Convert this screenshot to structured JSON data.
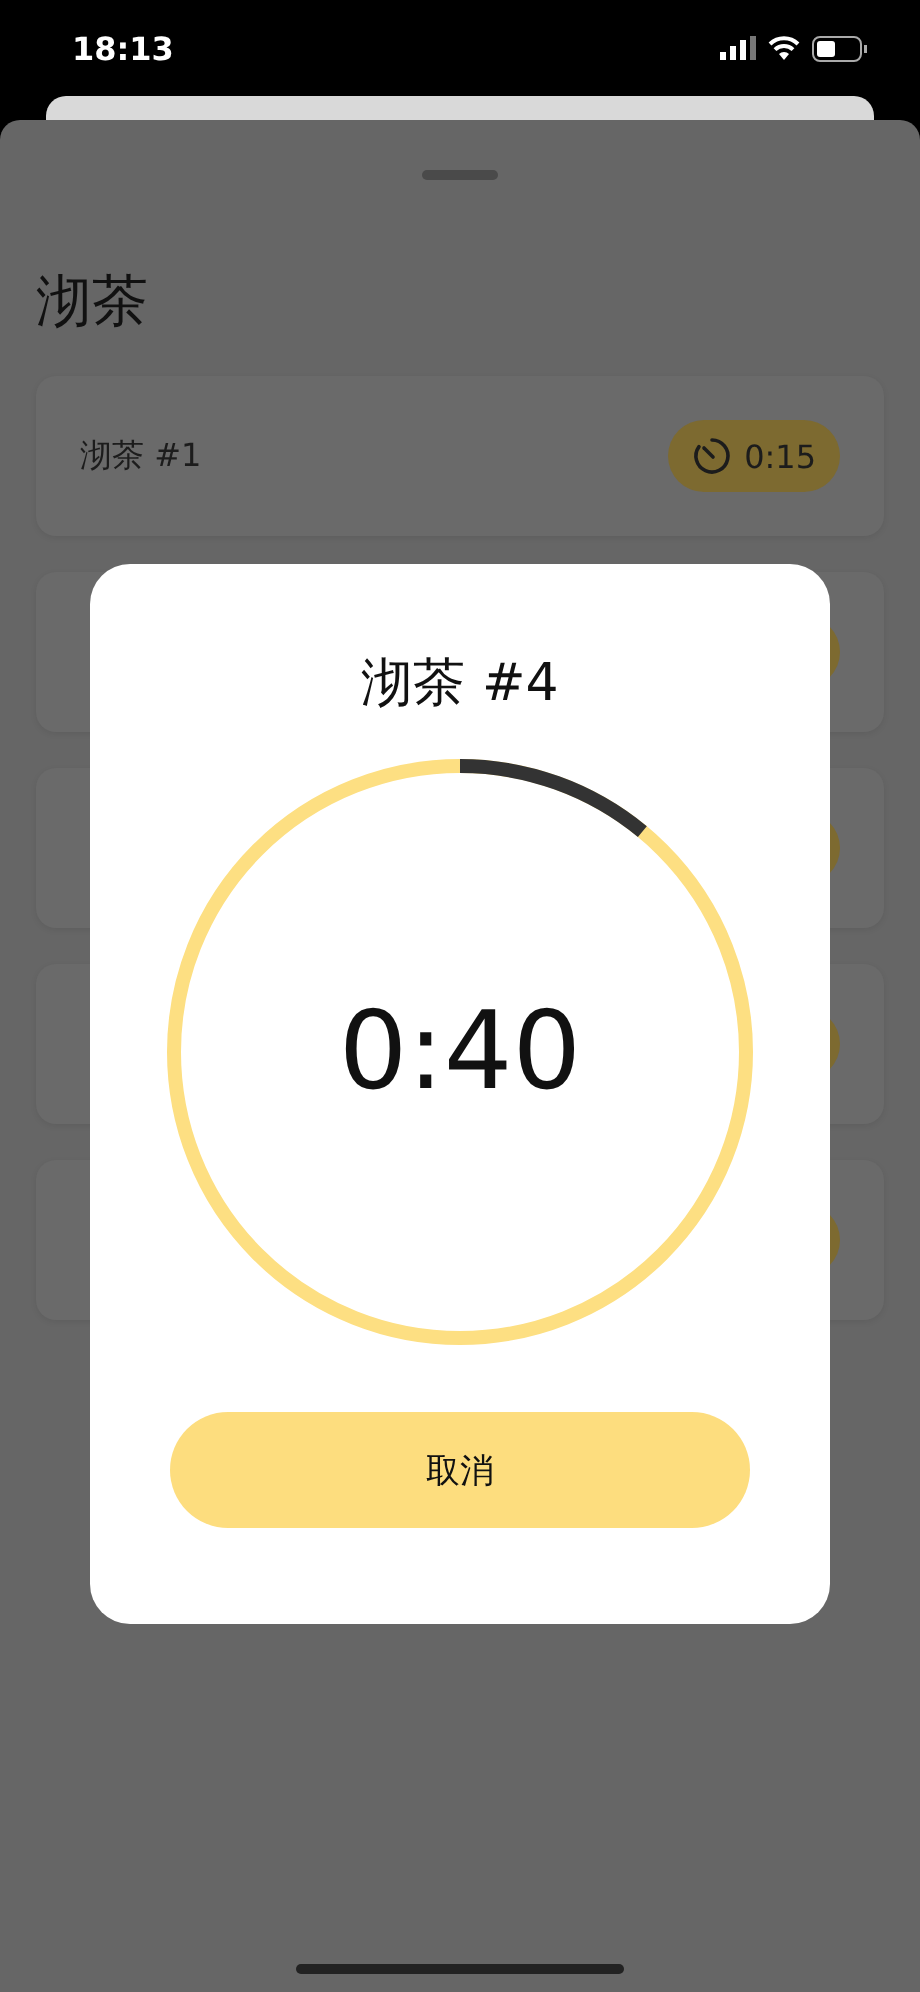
{
  "status_bar": {
    "time": "18:13"
  },
  "sheet": {
    "title": "沏茶",
    "rows": [
      {
        "label": "沏茶 #1",
        "timer": "0:15"
      },
      {},
      {},
      {},
      {}
    ]
  },
  "dialog": {
    "title": "沏茶 #4",
    "time": "0:40",
    "level": 0.11,
    "cancel": "取消"
  }
}
